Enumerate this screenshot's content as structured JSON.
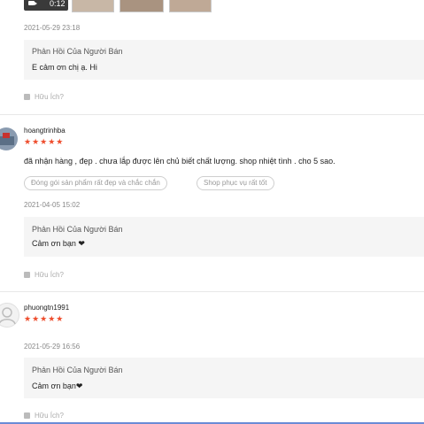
{
  "media": {
    "video_duration": "0:12",
    "video_icon": "video-camera-icon"
  },
  "reviews": [
    {
      "timestamp": "2021-05-29 23:18",
      "seller_reply_title": "Phản Hồi Của Người Bán",
      "seller_reply_text": "E cảm ơn chị ạ. Hi",
      "helpful_label": "Hữu Ích?"
    },
    {
      "username": "hoangtrinhba",
      "stars": "★★★★★",
      "rating": 5,
      "review_text": "đã nhận hàng , đẹp . chưa lắp được lên chủ biết chất lượng.  shop nhiệt tình . cho 5 sao.",
      "tags": [
        "Đóng gói sản phẩm rất đẹp và chắc chắn",
        "Shop phục vụ rất tốt"
      ],
      "timestamp": "2021-04-05 15:02",
      "seller_reply_title": "Phản Hồi Của Người Bán",
      "seller_reply_text": "Cảm ơn bạn ❤",
      "helpful_label": "Hữu Ích?"
    },
    {
      "username": "phuongtn1991",
      "stars": "★★★★★",
      "rating": 5,
      "timestamp": "2021-05-29 16:56",
      "seller_reply_title": "Phản Hồi Của Người Bán",
      "seller_reply_text": "Cảm ơn bạn❤",
      "helpful_label": "Hữu Ích?"
    }
  ],
  "colors": {
    "star": "#ee4d2d",
    "reply_bg": "#f5f5f5",
    "muted": "#888888"
  }
}
